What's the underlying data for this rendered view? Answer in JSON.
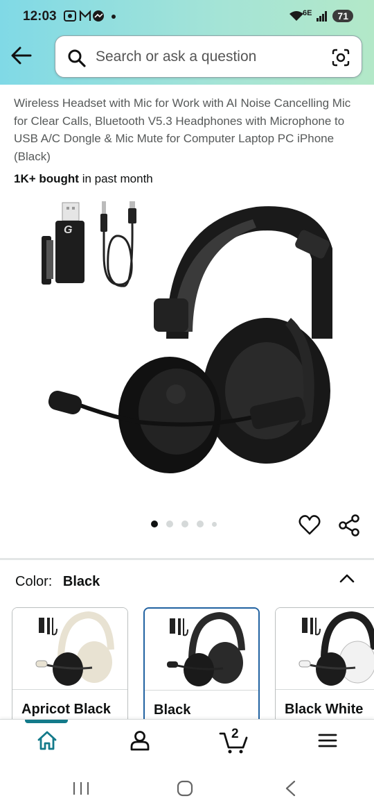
{
  "status_bar": {
    "time": "12:03",
    "battery": "71",
    "network": "6E"
  },
  "search": {
    "placeholder": "Search or ask a question"
  },
  "product": {
    "title": "Wireless Headset with Mic for Work with AI Noise Cancelling Mic for Clear Calls, Bluetooth V5.3 Headphones with Microphone to USB A/C Dongle & Mic Mute for Computer Laptop PC iPhone (Black)",
    "bought_strong": "1K+ bought",
    "bought_rest": " in past month",
    "image_count": 5,
    "current_image": 1
  },
  "color": {
    "label": "Color:",
    "selected": "Black",
    "options": [
      {
        "name": "Apricot Black",
        "cup": "#e8e2d2"
      },
      {
        "name": "Black",
        "cup": "#2a2a2a"
      },
      {
        "name": "Black White",
        "cup": "#f2f2f2"
      }
    ]
  },
  "bottom_nav": {
    "cart_count": "2"
  },
  "icons": [
    "back-arrow-icon",
    "search-icon",
    "camera-scan-icon",
    "heart-icon",
    "share-icon",
    "chevron-up-icon",
    "home-icon",
    "account-icon",
    "cart-icon",
    "menu-icon"
  ]
}
